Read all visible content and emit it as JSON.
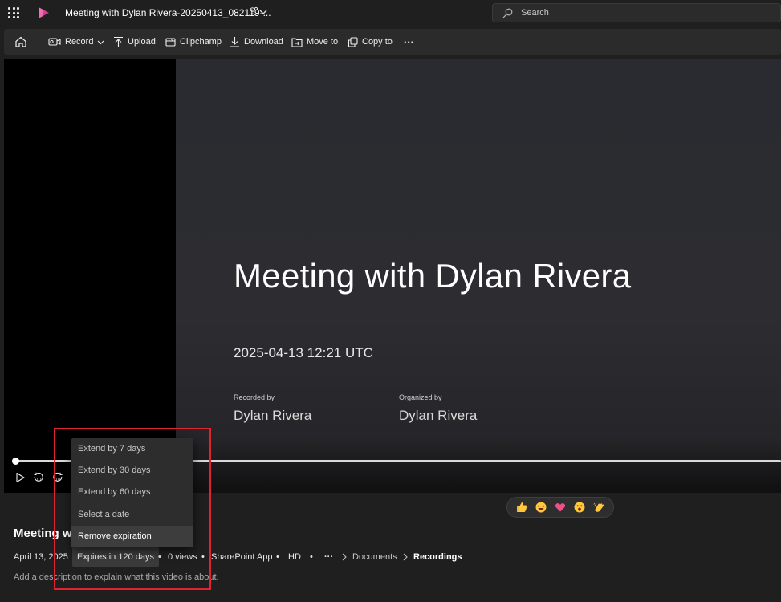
{
  "app": {
    "title": "Meeting with Dylan Rivera-20250413_082119-...",
    "search_placeholder": "Search"
  },
  "toolbar": {
    "record_label": "Record",
    "upload_label": "Upload",
    "clipchamp_label": "Clipchamp",
    "download_label": "Download",
    "move_to_label": "Move to",
    "copy_to_label": "Copy to",
    "more_label": "···"
  },
  "slide": {
    "title": "Meeting with Dylan Rivera",
    "datetime": "2025-04-13 12:21 UTC",
    "recorded_by_label": "Recorded by",
    "recorded_by": "Dylan Rivera",
    "organized_by_label": "Organized by",
    "organized_by": "Dylan Rivera"
  },
  "player": {
    "progress": 0.0,
    "skip_back_seconds": "10",
    "skip_forward_seconds": "10"
  },
  "expiration_menu": {
    "items": [
      "Extend by 7 days",
      "Extend by 30 days",
      "Extend by 60 days",
      "Select a date",
      "Remove expiration"
    ],
    "highlighted_index": 4
  },
  "reactions": {
    "items": [
      "👍",
      "😆",
      "❤️",
      "😮",
      "👏"
    ]
  },
  "info": {
    "title_visible": "Meeting w",
    "date": "April 13, 2025",
    "expires": "Expires in 120 days",
    "views": "0 views",
    "source": "SharePoint App",
    "quality": "HD",
    "more": "···",
    "breadcrumb": [
      "Documents",
      "Recordings"
    ],
    "description_placeholder": "Add a description to explain what this video is about."
  },
  "colors": {
    "background": "#1f1f1f",
    "toolbar": "#2b2b2b",
    "highlight_box": "#e0232e",
    "menu": "#2d2d2d",
    "brand": "#e33d8f"
  }
}
